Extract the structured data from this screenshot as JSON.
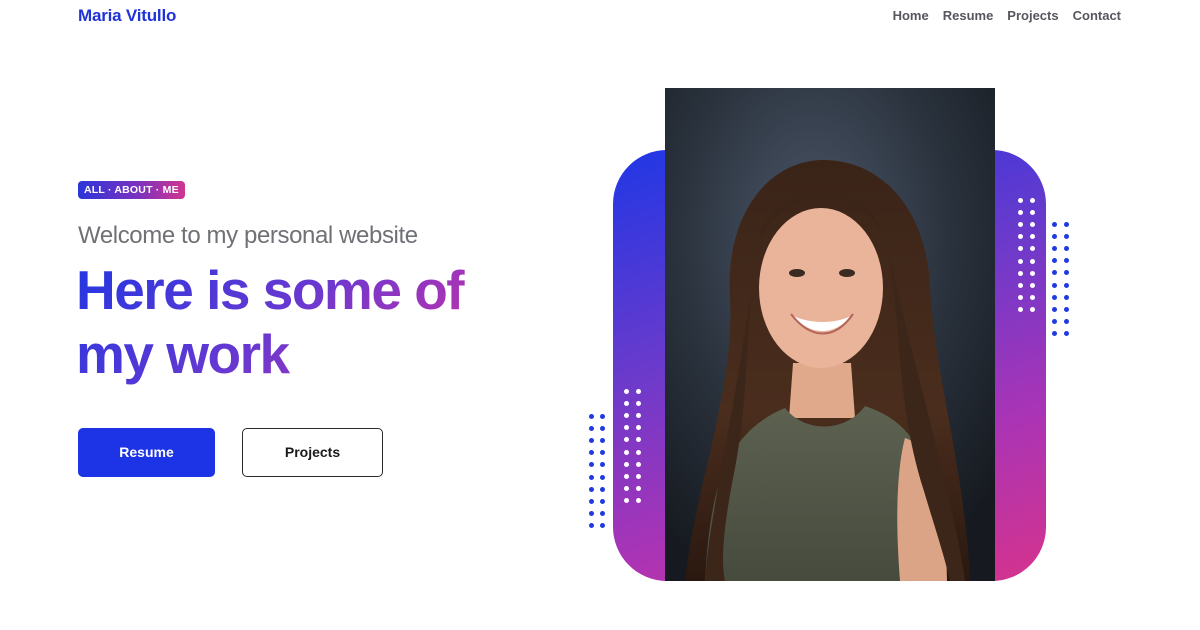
{
  "header": {
    "brand": "Maria Vitullo",
    "nav": [
      "Home",
      "Resume",
      "Projects",
      "Contact"
    ]
  },
  "hero": {
    "badge": "ALL · ABOUT · ME",
    "welcome": "Welcome to my personal website",
    "headline_line1": "Here is some of",
    "headline_line2": "my work",
    "primary_button": "Resume",
    "secondary_button": "Projects",
    "photo_alt": "Portrait of Maria Vitullo"
  },
  "colors": {
    "brand_blue": "#1f33d6",
    "button_blue": "#1d33e6",
    "gradient_start": "#1f37e6",
    "gradient_mid": "#7a32c0",
    "gradient_end": "#d6338c",
    "nav_text": "#55575c"
  }
}
